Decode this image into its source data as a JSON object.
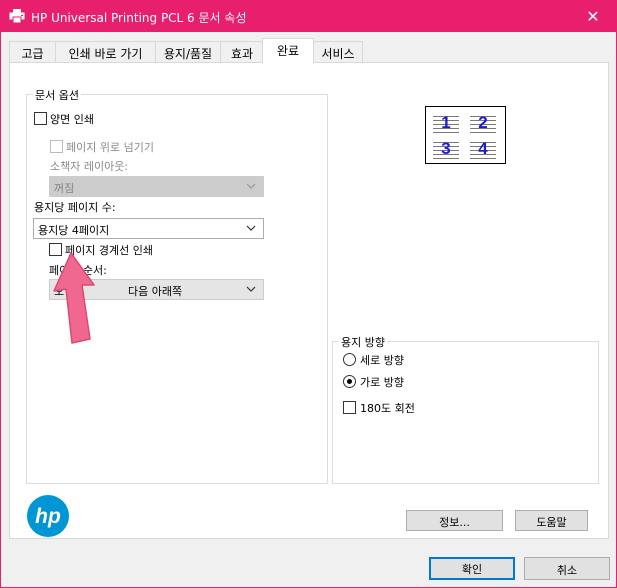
{
  "window": {
    "title": "HP Universal Printing PCL 6 문서 속성",
    "close_glyph": "✕"
  },
  "tabs": [
    {
      "label": "고급"
    },
    {
      "label": "인쇄 바로 가기"
    },
    {
      "label": "용지/품질"
    },
    {
      "label": "효과"
    },
    {
      "label": "완료",
      "active": true
    },
    {
      "label": "서비스"
    }
  ],
  "document_options": {
    "title": "문서 옵션",
    "duplex_label": "양면 인쇄",
    "flip_pages_label": "페이지 위로 넘기기",
    "booklet_layout_label": "소책자 레이아웃:",
    "booklet_layout_value": "꺼짐",
    "pages_per_sheet_label": "용지당 페이지 수:",
    "pages_per_sheet_value": "용지당 4페이지",
    "print_page_borders_label": "페이지 경계선 인쇄",
    "page_order_label": "페이지 순서:",
    "page_order_value_left": "오",
    "page_order_value_right": "다음 아래쪽"
  },
  "preview": {
    "numbers": [
      "1",
      "2",
      "3",
      "4"
    ]
  },
  "orientation": {
    "title": "용지 방향",
    "portrait_label": "세로 방향",
    "landscape_label": "가로 방향",
    "rotate_label": "180도 회전",
    "selected": "landscape"
  },
  "panel_buttons": {
    "about_label": "정보...",
    "help_label": "도움말"
  },
  "footer_buttons": {
    "ok_label": "확인",
    "cancel_label": "취소"
  },
  "colors": {
    "titlebar": "#e81f6c",
    "hp_blue": "#0096d6",
    "arrow_pink": "#f0688f",
    "preview_digits": "#1c1ccc"
  },
  "icons": {
    "printer": "printer-icon",
    "chevron": "chevron-down-icon",
    "hp_logo": "hp-logo",
    "annotation_arrow": "pink-up-arrow"
  }
}
